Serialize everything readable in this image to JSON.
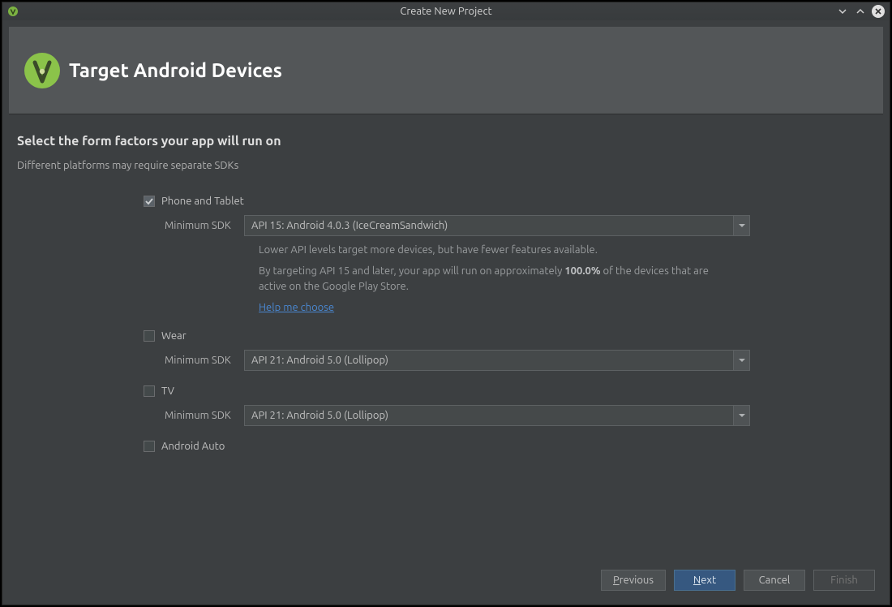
{
  "window": {
    "title": "Create New Project"
  },
  "banner": {
    "title": "Target Android Devices"
  },
  "heading": "Select the form factors your app will run on",
  "subtitle": "Different platforms may require separate SDKs",
  "form": {
    "phone": {
      "label": "Phone and Tablet",
      "sdk_label": "Minimum SDK",
      "sdk_value": "API 15: Android 4.0.3 (IceCreamSandwich)",
      "hint1": "Lower API levels target more devices, but have fewer features available.",
      "hint2a": "By targeting API 15 and later, your app will run on approximately ",
      "hint2b_pct": "100.0%",
      "hint2c": " of the devices that are active on the Google Play Store.",
      "help_link": "Help me choose"
    },
    "wear": {
      "label": "Wear",
      "sdk_label": "Minimum SDK",
      "sdk_value": "API 21: Android 5.0 (Lollipop)"
    },
    "tv": {
      "label": "TV",
      "sdk_label": "Minimum SDK",
      "sdk_value": "API 21: Android 5.0 (Lollipop)"
    },
    "auto": {
      "label": "Android Auto"
    }
  },
  "buttons": {
    "previous": "revious",
    "previous_u": "P",
    "next": "ext",
    "next_u": "N",
    "cancel": "Cancel",
    "finish": "Finish"
  }
}
